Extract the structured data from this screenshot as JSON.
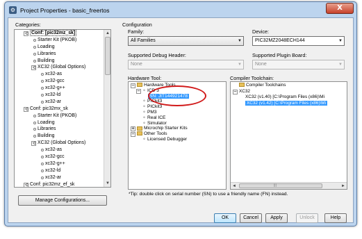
{
  "window": {
    "title": "Project Properties - basic_freertos",
    "close_glyph": "X",
    "icon_glyph": "⚙"
  },
  "categories": {
    "label": "Categories:",
    "items": [
      {
        "text": "Conf: [pic32mz_sk]",
        "level": 0,
        "toggle": "−",
        "selected": true
      },
      {
        "text": "Starter Kit (PKOB)",
        "level": 1
      },
      {
        "text": "Loading",
        "level": 1
      },
      {
        "text": "Libraries",
        "level": 1
      },
      {
        "text": "Building",
        "level": 1
      },
      {
        "text": "XC32 (Global Options)",
        "level": 1,
        "toggle": "−"
      },
      {
        "text": "xc32-as",
        "level": 2
      },
      {
        "text": "xc32-gcc",
        "level": 2
      },
      {
        "text": "xc32-g++",
        "level": 2
      },
      {
        "text": "xc32-ld",
        "level": 2
      },
      {
        "text": "xc32-ar",
        "level": 2
      },
      {
        "text": "Conf: pic32mx_sk",
        "level": 0,
        "toggle": "−"
      },
      {
        "text": "Starter Kit (PKOB)",
        "level": 1
      },
      {
        "text": "Loading",
        "level": 1
      },
      {
        "text": "Libraries",
        "level": 1
      },
      {
        "text": "Building",
        "level": 1
      },
      {
        "text": "XC32 (Global Options)",
        "level": 1,
        "toggle": "−"
      },
      {
        "text": "xc32-as",
        "level": 2
      },
      {
        "text": "xc32-gcc",
        "level": 2
      },
      {
        "text": "xc32-g++",
        "level": 2
      },
      {
        "text": "xc32-ld",
        "level": 2
      },
      {
        "text": "xc32-ar",
        "level": 2
      },
      {
        "text": "Conf: pic32mz_ef_sk",
        "level": 0,
        "toggle": "−"
      },
      {
        "text": "Starter Kit (PKOB)",
        "level": 1
      }
    ],
    "manage_button": "Manage Configurations..."
  },
  "configuration": {
    "label": "Configuration",
    "family_label": "Family:",
    "family_value": "All Families",
    "device_label": "Device:",
    "device_value": "PIC32MZ2048ECH144",
    "debug_header_label": "Supported Debug Header:",
    "debug_header_value": "None",
    "plugin_board_label": "Supported Plugin Board:",
    "plugin_board_value": "None"
  },
  "hardware_tool": {
    "label": "Hardware Tool:",
    "items": [
      {
        "text": "Hardware Tools",
        "level": 0,
        "toggle": "−",
        "icon": "folder"
      },
      {
        "text": "ICD 3",
        "level": 1,
        "toggle": "−",
        "icon": "tool"
      },
      {
        "text": "SN: JIT144921478",
        "level": 2,
        "highlight": true
      },
      {
        "text": "PICkit3",
        "level": 1,
        "icon": "tool"
      },
      {
        "text": "PICkit3",
        "level": 1,
        "icon": "tool"
      },
      {
        "text": "PM3",
        "level": 1,
        "icon": "tool"
      },
      {
        "text": "Real ICE",
        "level": 1,
        "icon": "tool"
      },
      {
        "text": "Simulator",
        "level": 1,
        "icon": "tool"
      },
      {
        "text": "Microchip Starter Kits",
        "level": 0,
        "toggle": "+",
        "icon": "folder"
      },
      {
        "text": "Other Tools",
        "level": 0,
        "toggle": "−",
        "icon": "folder"
      },
      {
        "text": "Licensed Debugger",
        "level": 1,
        "icon": "tool"
      }
    ]
  },
  "compiler_toolchain": {
    "label": "Compiler Toolchain:",
    "items": [
      {
        "text": "Compiler Toolchains",
        "level": 0,
        "icon": "folder"
      },
      {
        "text": "XC32",
        "level": 0,
        "toggle": "−"
      },
      {
        "text": "XC32 (v1.40) [C:\\Program Files (x86)\\Mi",
        "level": 1
      },
      {
        "text": "XC32 (v1.42) [C:\\Program Files (x86)\\Mi",
        "level": 1,
        "highlight": true
      }
    ],
    "scroll_grip": "|||"
  },
  "tip": "*Tip: double click on serial number (SN) to use a friendly name (FN) instead.",
  "buttons": {
    "ok": "OK",
    "cancel": "Cancel",
    "apply": "Apply",
    "unlock": "Unlock",
    "help": "Help"
  },
  "colors": {
    "highlight": "#3399ff",
    "annotation": "#d11a1a",
    "titlebar": "#bcd4ee"
  }
}
